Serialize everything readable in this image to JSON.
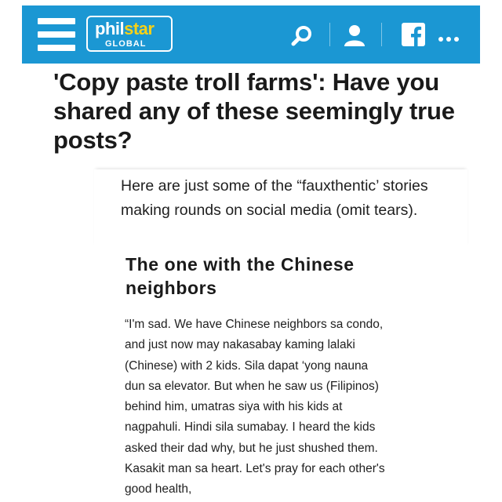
{
  "header": {
    "logo_text_main_1": "phil",
    "logo_text_main_2": "star",
    "logo_text_sub": "GLOBAL",
    "bar_color": "#1b97d3",
    "icons": [
      "menu-icon",
      "search-icon",
      "user-icon",
      "facebook-icon",
      "more-icon"
    ]
  },
  "article": {
    "headline": "'Copy paste troll farms': Have you shared any of these seemingly true posts?",
    "lead": "Here are just some of the “fauxthentic’ stories making rounds on social media (omit tears).",
    "section_title": "The one with the Chinese neighbors",
    "body": "“I'm sad. We have Chinese neighbors sa condo, and just now may nakasabay kaming lalaki (Chinese) with 2 kids. Sila dapat ‘yong nauna dun sa elevator. But when he saw us (Filipinos) behind him, umatras siya with his kids at nagpahuli. Hindi sila sumabay. I heard the kids asked their dad why, but he just shushed them. Kasakit man sa heart. Let's pray for each other's good health,"
  }
}
